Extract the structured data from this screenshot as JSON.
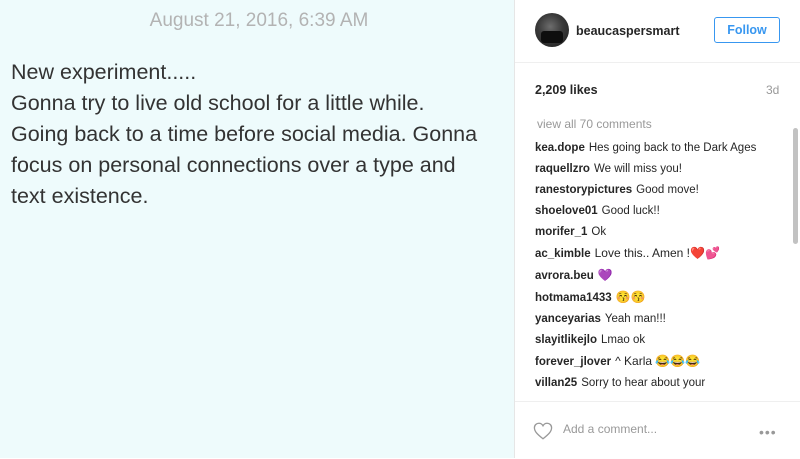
{
  "note": {
    "date": "August 21, 2016, 6:39 AM",
    "lines": [
      "New experiment.....",
      "Gonna try to live old school for a little while.",
      "Going back to a time before social media. Gonna",
      "focus on personal connections over a type and",
      "text existence."
    ]
  },
  "post": {
    "username": "beaucaspersmart",
    "follow_label": "Follow",
    "likes": "2,209 likes",
    "age": "3d",
    "view_all": "view all 70 comments",
    "comments": [
      {
        "user": "kea.dope",
        "text": "Hes going back to the Dark Ages"
      },
      {
        "user": "raquellzro",
        "text": "We will miss you!"
      },
      {
        "user": "ranestorypictures",
        "text": "Good move!"
      },
      {
        "user": "shoelove01",
        "text": "Good luck!!"
      },
      {
        "user": "morifer_1",
        "text": "Ok"
      },
      {
        "user": "ac_kimble",
        "text": "Love this.. Amen !❤️💕"
      },
      {
        "user": "avrora.beu",
        "text": "💜"
      },
      {
        "user": "hotmama1433",
        "text": "😚😚"
      },
      {
        "user": "yanceyarias",
        "text": "Yeah man!!!"
      },
      {
        "user": "slayitlikejlo",
        "text": "Lmao ok"
      },
      {
        "user": "forever_jlover",
        "text": "^ Karla 😂😂😂"
      },
      {
        "user": "villan25",
        "text": "Sorry to hear about your"
      }
    ],
    "add_comment_placeholder": "Add a comment...",
    "more_label": "•••"
  },
  "colors": {
    "note_background": "#eefbfc",
    "accent": "#3897f0"
  },
  "icons": {
    "like": "heart-outline-icon",
    "more": "more-options-icon"
  }
}
